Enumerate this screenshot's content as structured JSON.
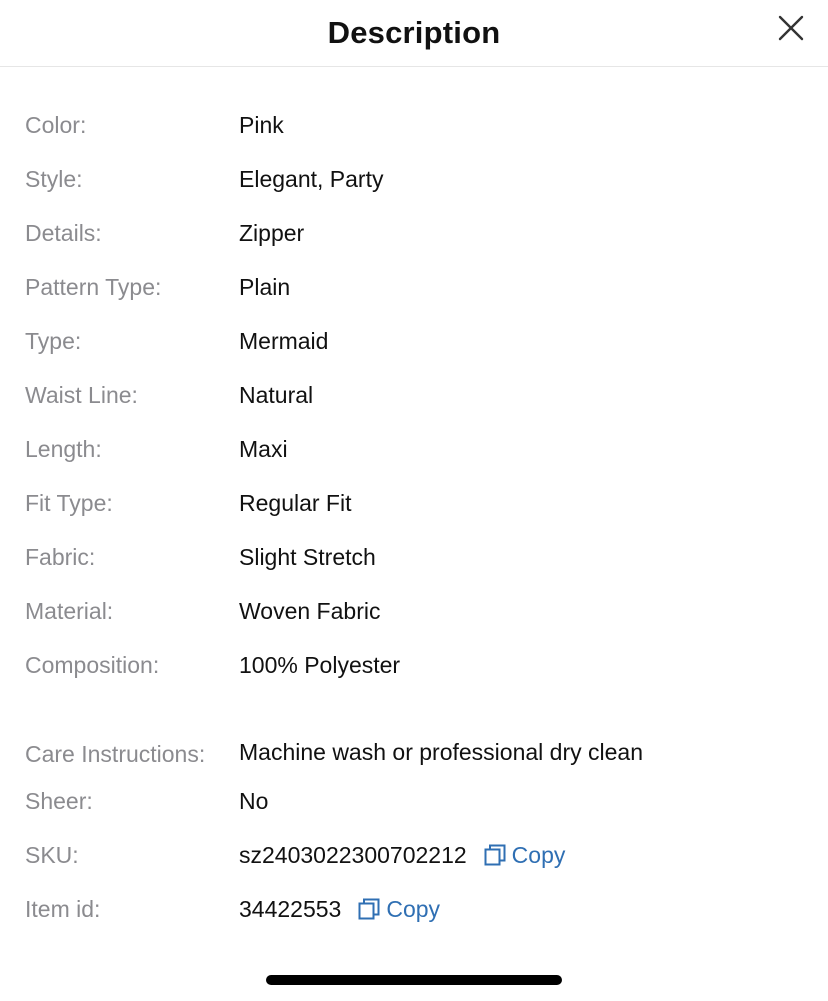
{
  "header": {
    "title": "Description",
    "close_icon": "close-icon"
  },
  "attributes": [
    {
      "label": "Color:",
      "value": "Pink"
    },
    {
      "label": "Style:",
      "value": "Elegant, Party"
    },
    {
      "label": "Details:",
      "value": "Zipper"
    },
    {
      "label": "Pattern Type:",
      "value": "Plain"
    },
    {
      "label": "Type:",
      "value": "Mermaid"
    },
    {
      "label": "Waist Line:",
      "value": "Natural"
    },
    {
      "label": "Length:",
      "value": "Maxi"
    },
    {
      "label": "Fit Type:",
      "value": "Regular Fit"
    },
    {
      "label": "Fabric:",
      "value": "Slight Stretch"
    },
    {
      "label": "Material:",
      "value": "Woven Fabric"
    },
    {
      "label": "Composition:",
      "value": "100% Polyester"
    },
    {
      "label": "Care Instructions:",
      "value": "Machine wash or professional dry clean"
    },
    {
      "label": "Sheer:",
      "value": "No"
    },
    {
      "label": "SKU:",
      "value": "sz2403022300702212",
      "copy_label": "Copy"
    },
    {
      "label": "Item id:",
      "value": "34422553",
      "copy_label": "Copy"
    }
  ],
  "colors": {
    "label": "#8b8b8f",
    "value": "#111111",
    "link": "#2f6fb3",
    "divider": "#e6e6e6"
  }
}
